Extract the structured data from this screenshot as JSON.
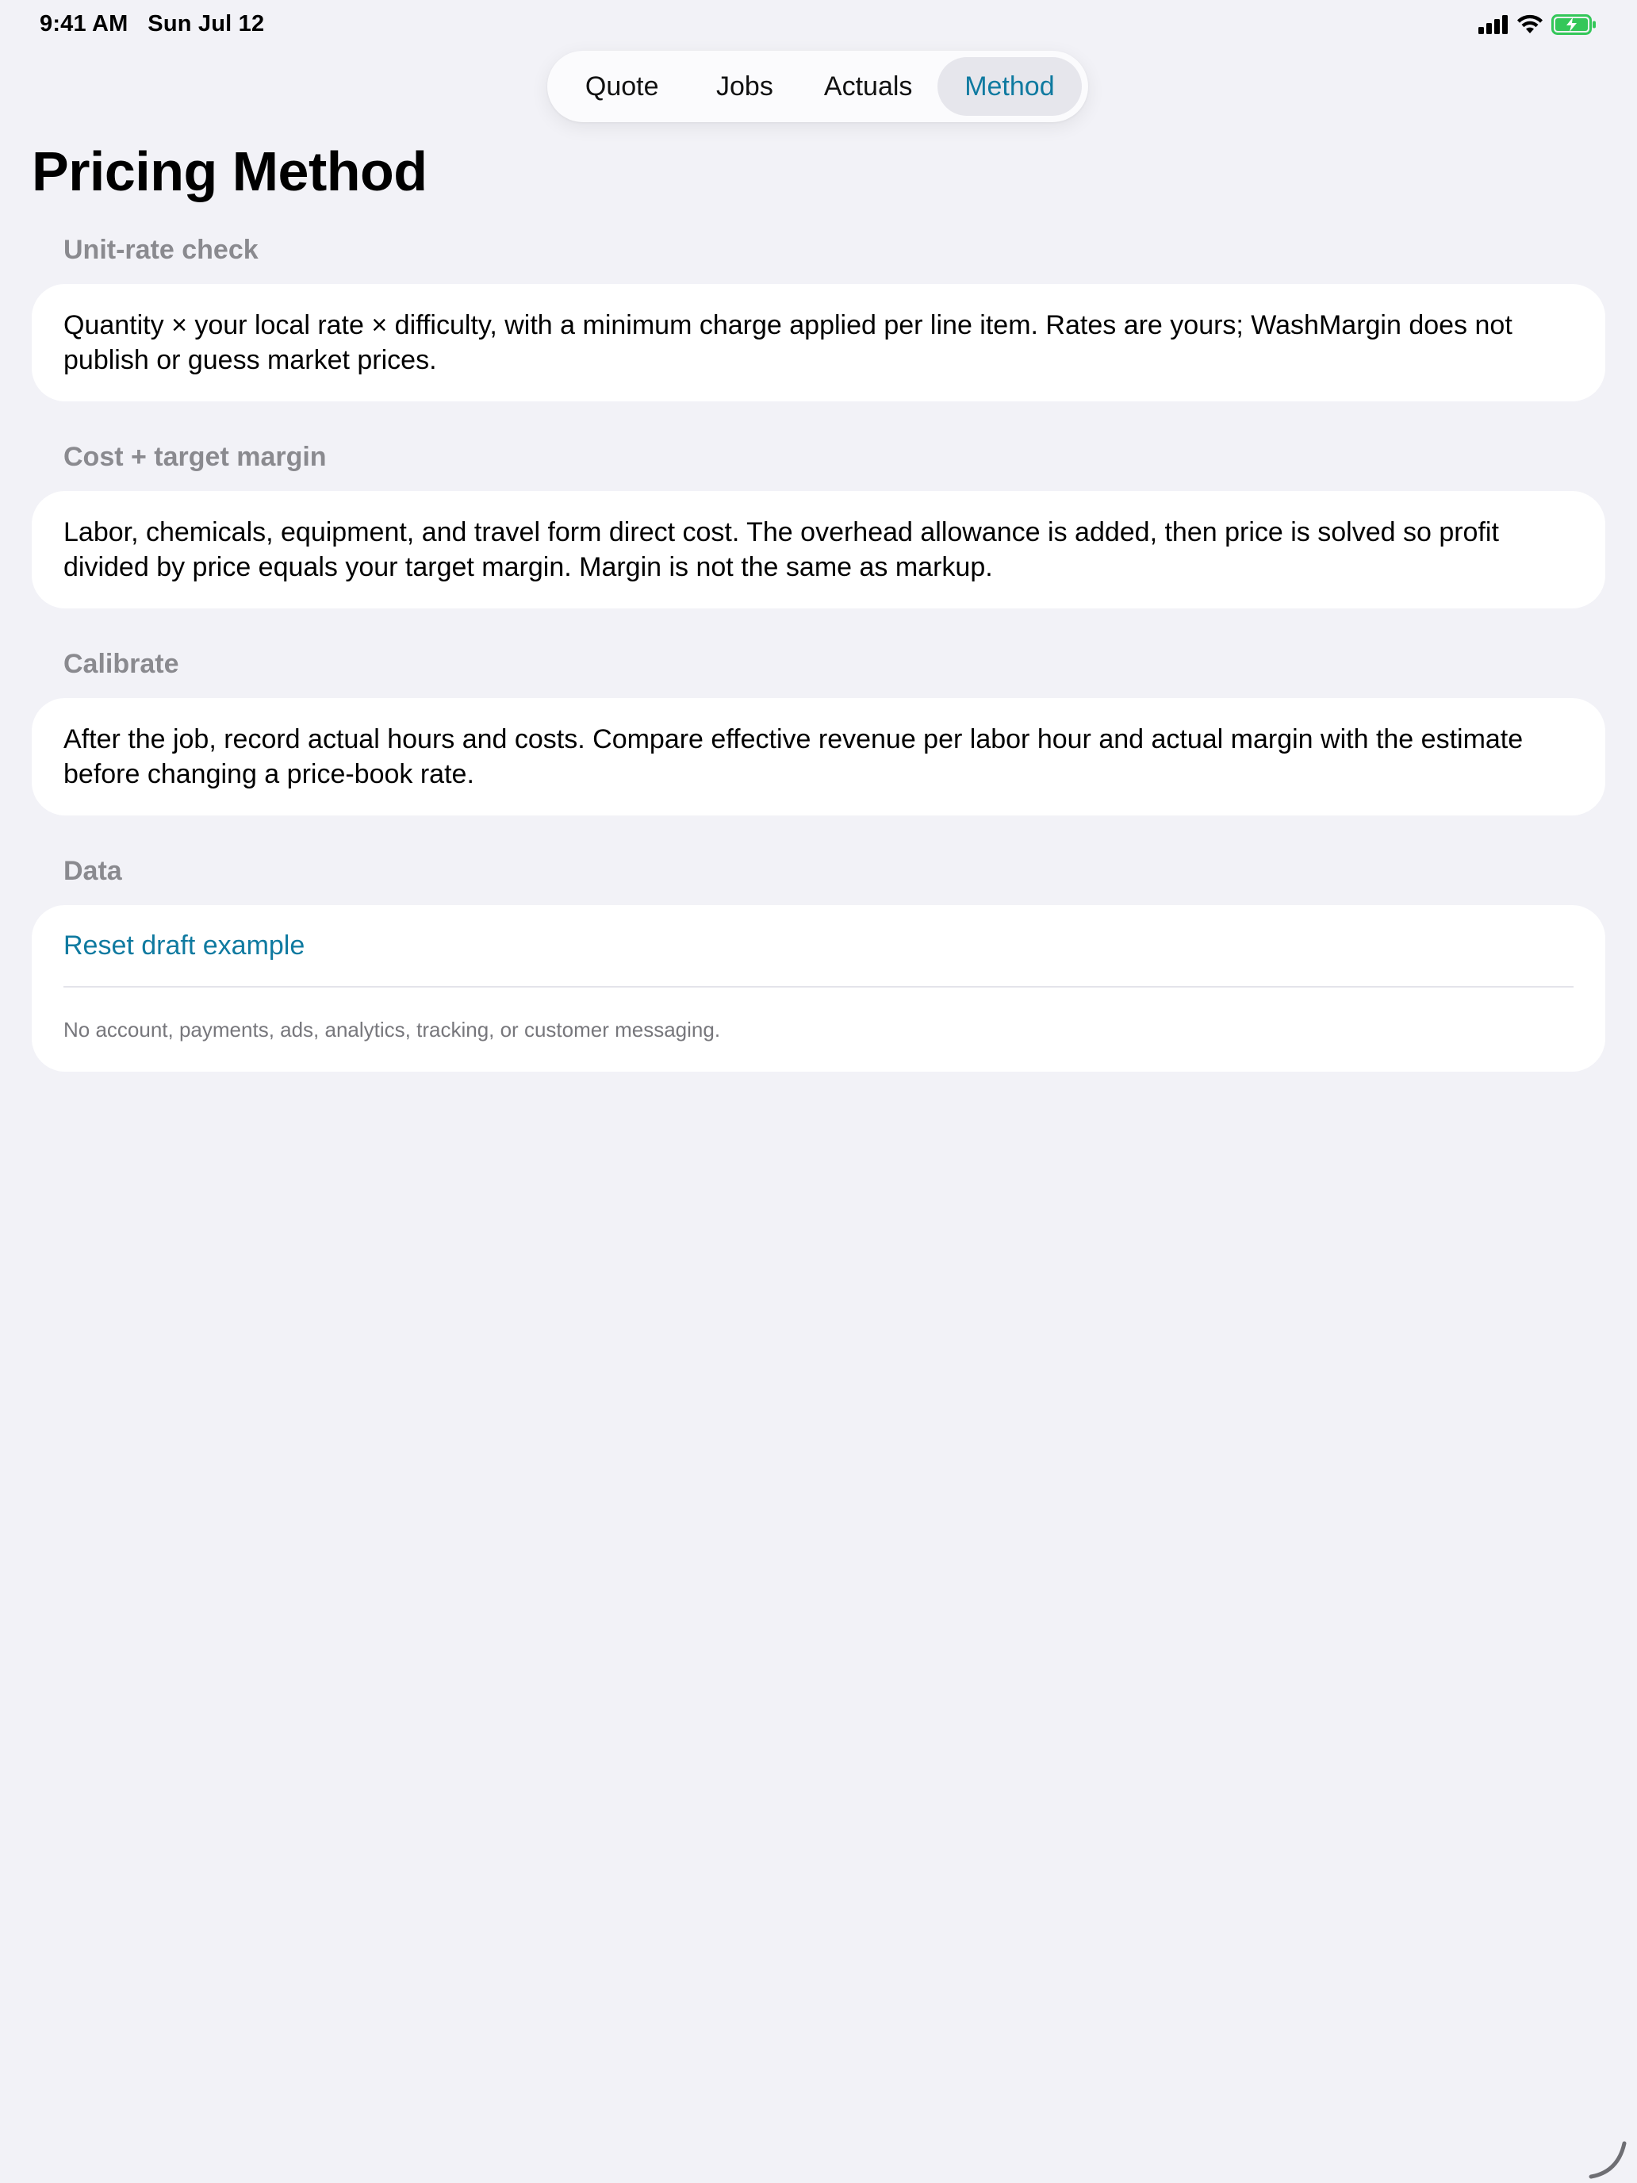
{
  "status_bar": {
    "time_date": "9:41 AM   Sun Jul 12",
    "icons": [
      "cellular-signal-icon",
      "wifi-icon",
      "battery-charging-icon"
    ],
    "battery_color": "#34c759"
  },
  "tabs": {
    "quote": "Quote",
    "jobs": "Jobs",
    "actuals": "Actuals",
    "method": "Method",
    "selected": "Method"
  },
  "page": {
    "title": "Pricing Method"
  },
  "sections": {
    "unit_rate": {
      "header": "Unit-rate check",
      "body": "Quantity × your local rate × difficulty, with a minimum charge applied per line item. Rates are yours; WashMargin does not publish or guess market prices."
    },
    "cost_margin": {
      "header": "Cost + target margin",
      "body": "Labor, chemicals, equipment, and travel form direct cost. The overhead allowance is added, then price is solved so profit divided by price equals your target margin. Margin is not the same as markup."
    },
    "calibrate": {
      "header": "Calibrate",
      "body": "After the job, record actual hours and costs. Compare effective revenue per labor hour and actual margin with the estimate before changing a price-book rate."
    },
    "data": {
      "header": "Data",
      "reset_label": "Reset draft example",
      "footnote": "No account, payments, ads, analytics, tracking, or customer messaging."
    }
  },
  "colors": {
    "accent": "#0f7aa0",
    "background": "#f2f2f7",
    "card": "#ffffff",
    "section_header": "#8a8a8f"
  }
}
